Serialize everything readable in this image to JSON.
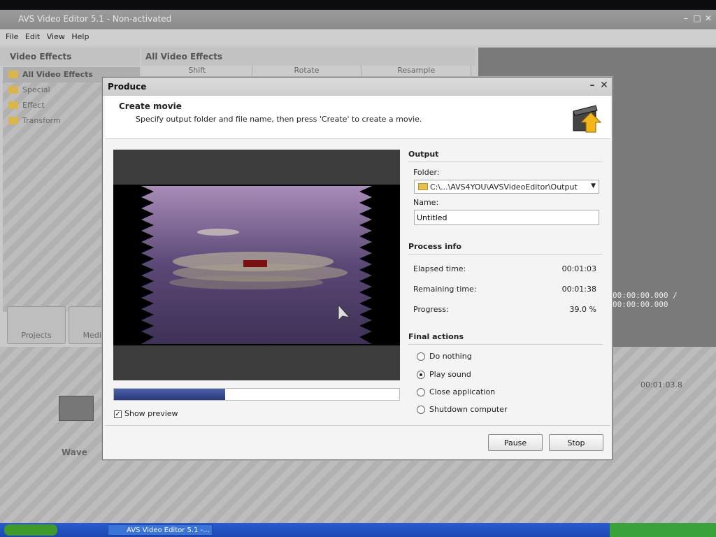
{
  "app": {
    "title": "AVS Video Editor 5.1 - Non-activated",
    "menu": [
      "File",
      "Edit",
      "View",
      "Help"
    ]
  },
  "left_panel": {
    "header": "Video Effects",
    "items": [
      "All Video Effects",
      "Special",
      "Effect",
      "Transform"
    ]
  },
  "mid_panel": {
    "header": "All Video Effects",
    "columns": [
      "Shift",
      "Rotate",
      "Resample"
    ]
  },
  "right_panel": {
    "timecode": "00:00:00.000 / 00:00:00.000"
  },
  "bottom": {
    "projects_label": "Projects",
    "media_label": "Media L",
    "timeline_time": "00:01:03.8",
    "track_label": "Wave"
  },
  "taskbar": {
    "item": "AVS Video Editor 5.1 -..."
  },
  "dialog": {
    "title": "Produce",
    "heading": "Create movie",
    "subheading": "Specify output folder and file name, then press 'Create' to create a movie.",
    "show_preview_label": "Show preview",
    "show_preview_checked": true,
    "progress_fraction": 0.39,
    "output": {
      "section": "Output",
      "folder_label": "Folder:",
      "folder_value": "C:\\...\\AVS4YOU\\AVSVideoEditor\\Output",
      "name_label": "Name:",
      "name_value": "Untitled"
    },
    "process": {
      "section": "Process info",
      "elapsed_label": "Elapsed time:",
      "elapsed_value": "00:01:03",
      "remaining_label": "Remaining time:",
      "remaining_value": "00:01:38",
      "progress_label": "Progress:",
      "progress_value": "39.0 %"
    },
    "final_actions": {
      "section": "Final actions",
      "options": [
        "Do nothing",
        "Play sound",
        "Close application",
        "Shutdown computer"
      ],
      "selected_index": 1
    },
    "buttons": {
      "pause": "Pause",
      "stop": "Stop"
    }
  }
}
